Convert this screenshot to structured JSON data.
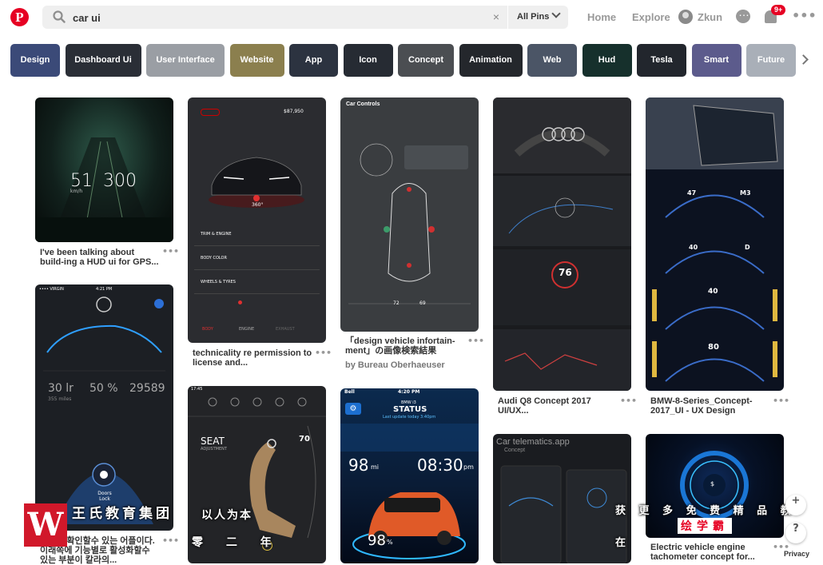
{
  "header": {
    "logo": "P",
    "search_value": "car ui",
    "clear_icon": "×",
    "scope_label": "All Pins",
    "nav": {
      "home": "Home",
      "explore": "Explore",
      "user": "Zkun"
    },
    "notification_badge": "9+",
    "more_icon": "•••"
  },
  "chips": [
    {
      "label": "Design",
      "color": "#3b4a78"
    },
    {
      "label": "Dashboard Ui",
      "color": "#2a2e36"
    },
    {
      "label": "User Interface",
      "color": "#9a9ea4"
    },
    {
      "label": "Website",
      "color": "#8b7f4e"
    },
    {
      "label": "App",
      "color": "#2c3340"
    },
    {
      "label": "Icon",
      "color": "#262b33"
    },
    {
      "label": "Concept",
      "color": "#4b4e52"
    },
    {
      "label": "Animation",
      "color": "#24272c"
    },
    {
      "label": "Web",
      "color": "#4b5566"
    },
    {
      "label": "Hud",
      "color": "#16302c"
    },
    {
      "label": "Tesla",
      "color": "#22262d"
    },
    {
      "label": "Smart",
      "color": "#5c5b8c"
    },
    {
      "label": "Future",
      "color": "#a9afb8"
    }
  ],
  "pins": {
    "p1": {
      "title": "I've been talking about build-ing a HUD ui for GPS...",
      "speed": "51",
      "limit": "300",
      "unit": "km/h"
    },
    "p2": {
      "title": "technicality re permission to license and...",
      "price": "$87,950",
      "deg": "360°",
      "rows": [
        "TRIM & ENGINE",
        "BODY COLOR",
        "WHEELS & TYRES"
      ],
      "tabs": [
        "BODY",
        "ENGINE",
        "EXHAUST"
      ]
    },
    "p3": {
      "title": "「design vehicle infortain-ment」の画像検索結果",
      "sub": "by Bureau Oberhaeuser",
      "heading": "Car Controls",
      "vals": [
        "72",
        "69"
      ]
    },
    "p4": {
      "title": "Audi Q8 Concept 2017 UI/UX...",
      "gauge": "76"
    },
    "p5": {
      "title": "BMW-8-Series_Concept-2017_UI - UX Design",
      "g1": "47",
      "g1b": "M3",
      "g2": "40",
      "g2b": "D",
      "g3": "40",
      "g4": "80"
    },
    "p6": {
      "title": "상태를 확인할수 있는 어플이다. 이래쪽에 기능별로 활성화할수 있는 부분이 칼라의...",
      "carrier": "•••• VIRGIN",
      "time": "4:21 PM",
      "stats": [
        "30 lr",
        "50 %",
        "29589"
      ],
      "miles": "355 miles",
      "lock": "Doors Lock"
    },
    "p7": {
      "seat": "SEAT",
      "adj": "ADJUSTMENT",
      "num": "70",
      "time": "17:45",
      "seat_num": "2"
    },
    "p8": {
      "carrier": "Bell",
      "time": "4:20 PM",
      "model": "BMW i3",
      "status": "STATUS",
      "update": "Last update today 3:40pm",
      "range": "98",
      "range_unit": "mi",
      "charge_time": "08:30",
      "charge_unit": "pm",
      "pct": "98",
      "pct_unit": "%"
    },
    "p9": {
      "heading": "Car telematics.app",
      "sub": "Concept"
    },
    "p10": {
      "title": "Electric vehicle engine tachometer concept for..."
    }
  },
  "watermark": {
    "logo": "W",
    "line1": "王氏教育集团",
    "line2": "以人为本",
    "line3": "零 二 年",
    "right1": "获 更 多 免 费 精 品 教",
    "right2": "在",
    "red": "绘学霸"
  },
  "side": {
    "plus": "+",
    "help": "?",
    "privacy": "Privacy"
  }
}
